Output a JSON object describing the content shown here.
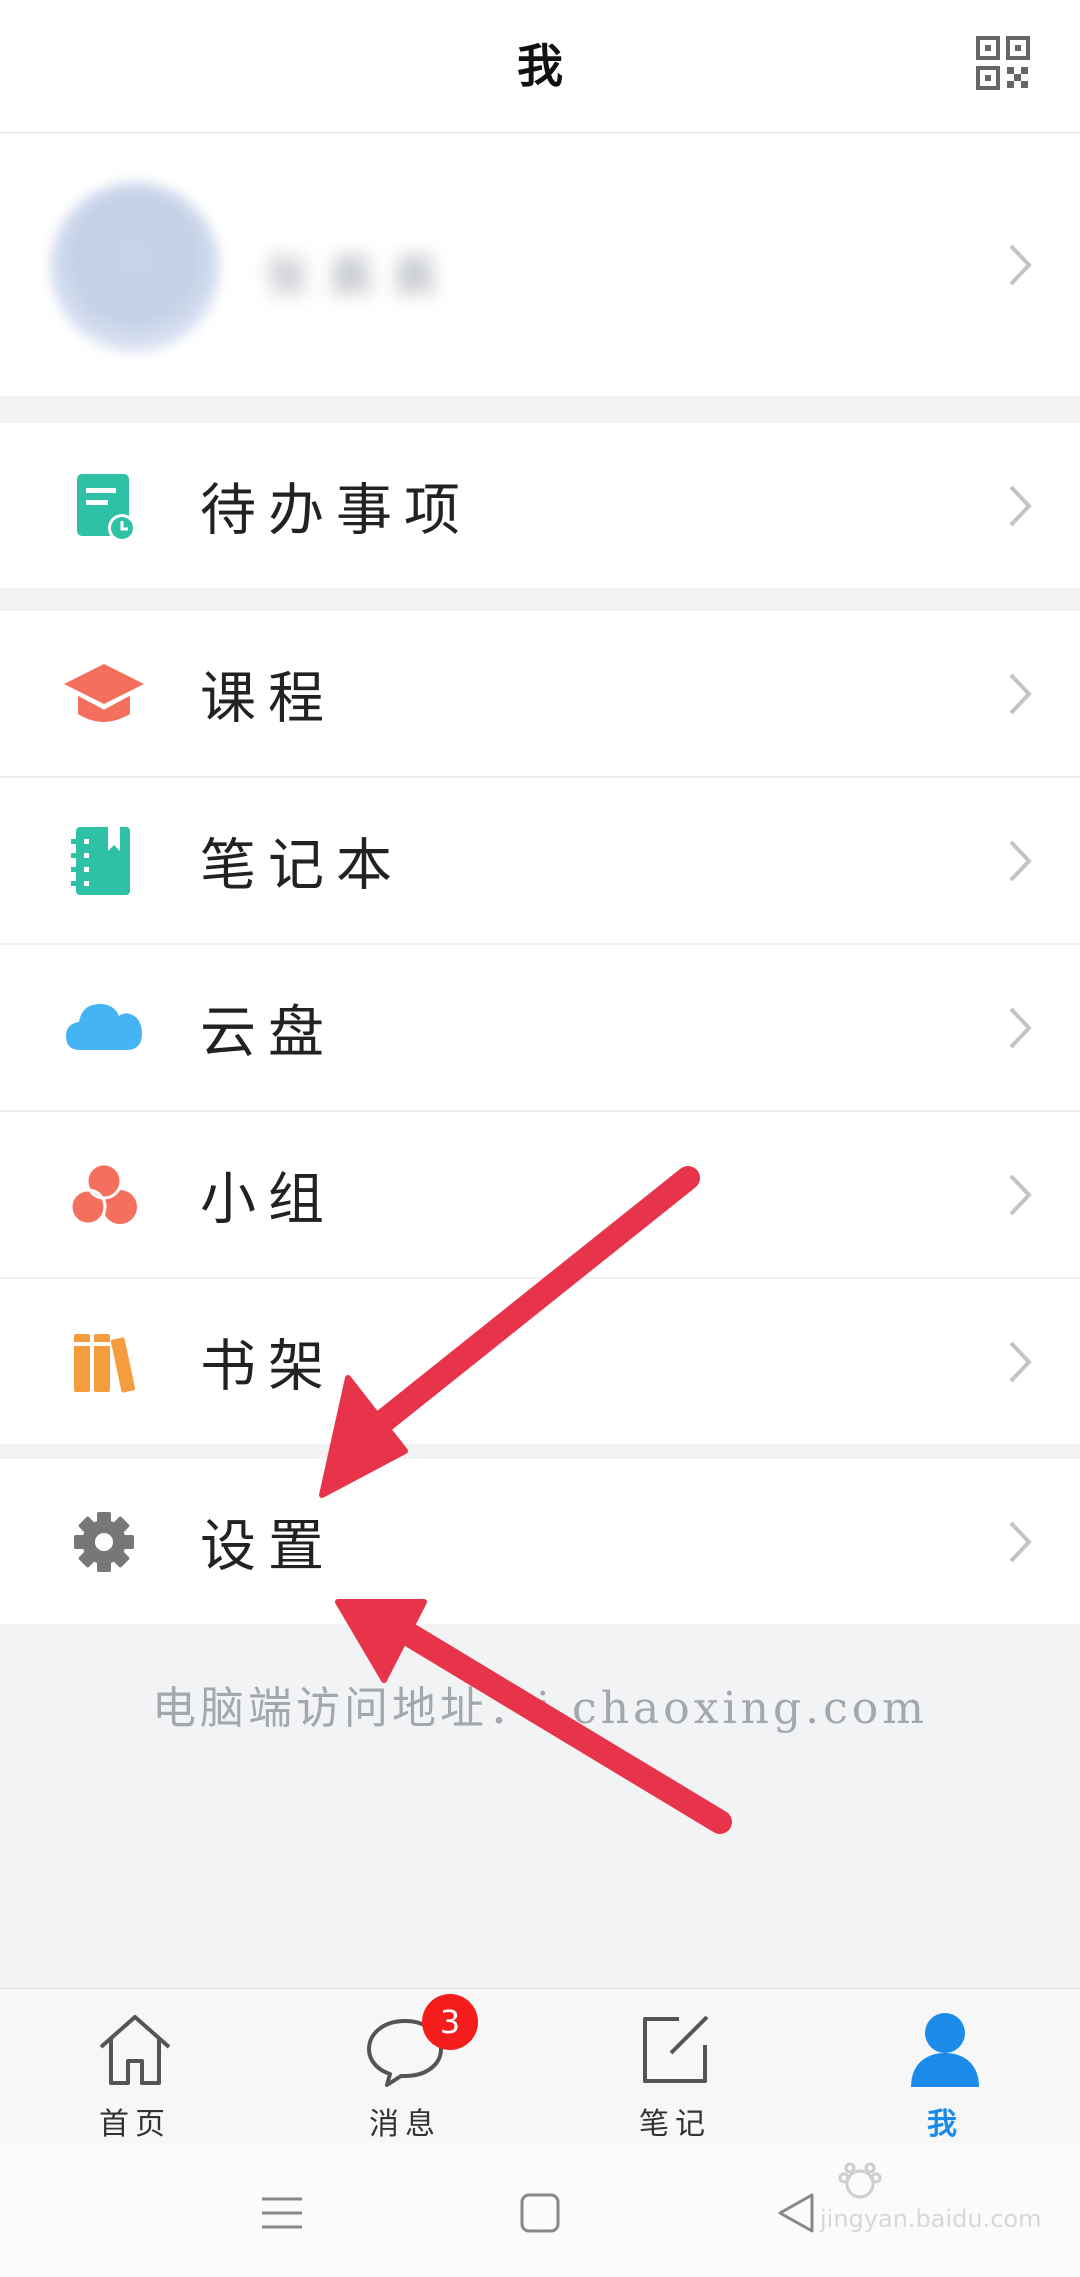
{
  "header": {
    "title": "我"
  },
  "profile": {
    "name": "张晨晨"
  },
  "menu": {
    "todo": "待办事项",
    "course": "课程",
    "notebook": "笔记本",
    "cloud": "云盘",
    "group": "小组",
    "bookshelf": "书架",
    "settings": "设置"
  },
  "footer_note": "电脑端访问地址：i.chaoxing.com",
  "tabs": {
    "home": "首页",
    "messages": "消息",
    "messages_badge": "3",
    "notes": "笔记",
    "me": "我"
  },
  "watermark": {
    "text": "jingyan.baidu.com"
  },
  "colors": {
    "accent": "#1a8be8",
    "badge": "#f51c1c",
    "arrow": "#e8344a"
  }
}
